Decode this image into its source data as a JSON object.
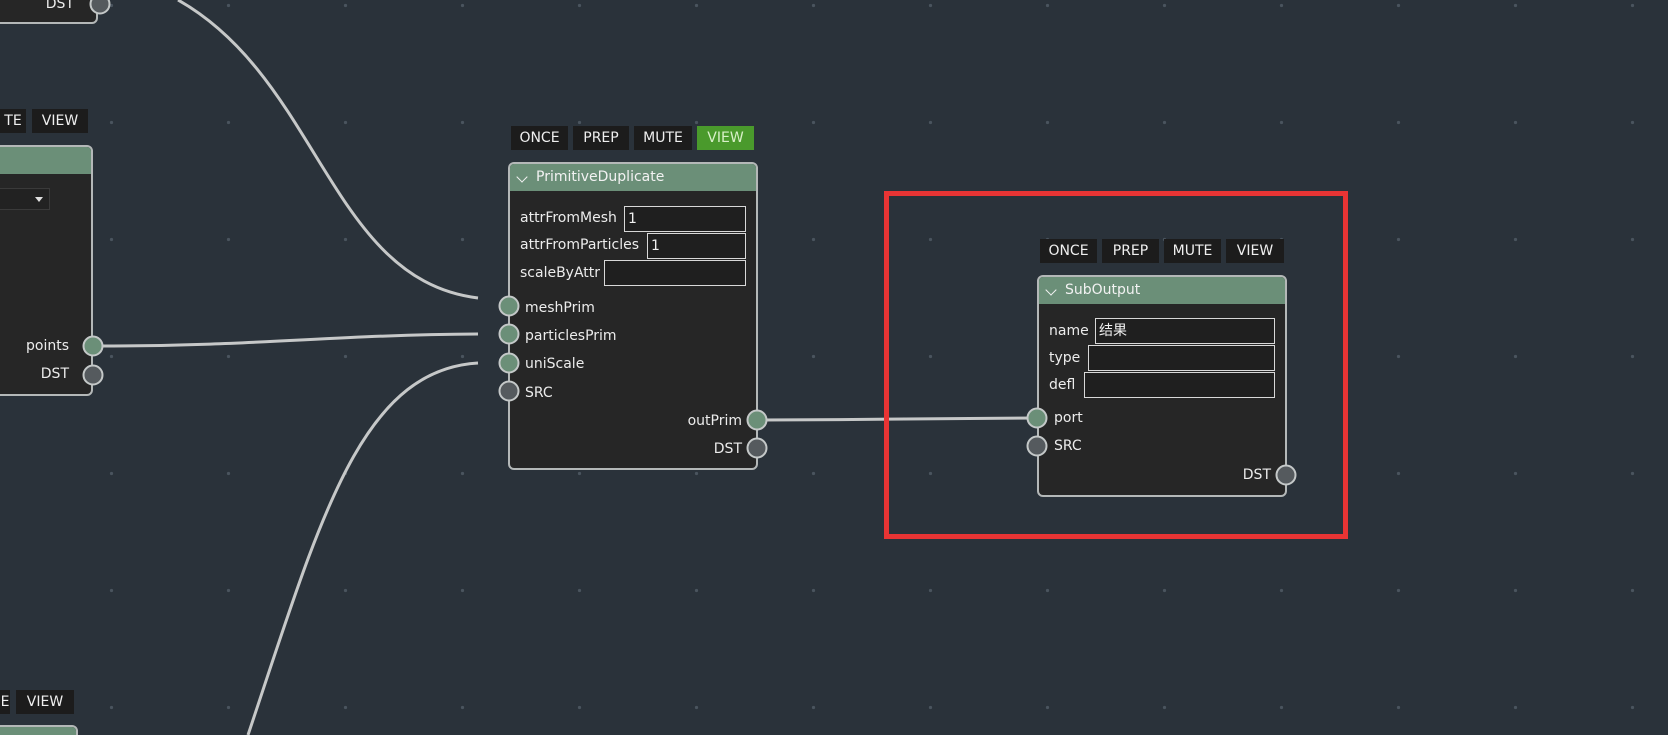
{
  "colors": {
    "background": "#2a323a",
    "node_header": "#6b8f78",
    "node_body": "#262626",
    "view_active": "#4a9a2c",
    "highlight": "#e83434"
  },
  "left_top_node": {
    "ports": {
      "dst": "DST"
    }
  },
  "left_mid_node": {
    "buttons": {
      "mute_partial": "TE",
      "view": "VIEW"
    },
    "ports": {
      "points": "points",
      "dst": "DST"
    }
  },
  "left_bottom_node": {
    "buttons": {
      "mute_partial": "E",
      "view": "VIEW"
    }
  },
  "primitive_duplicate": {
    "title": "PrimitiveDuplicate",
    "buttons": {
      "once": "ONCE",
      "prep": "PREP",
      "mute": "MUTE",
      "view": "VIEW"
    },
    "fields": {
      "attrFromMesh": {
        "label": "attrFromMesh",
        "value": "1"
      },
      "attrFromParticles": {
        "label": "attrFromParticles",
        "value": "1"
      },
      "scaleByAttr": {
        "label": "scaleByAttr",
        "value": ""
      }
    },
    "inputs": {
      "meshPrim": "meshPrim",
      "particlesPrim": "particlesPrim",
      "uniScale": "uniScale",
      "src": "SRC"
    },
    "outputs": {
      "outPrim": "outPrim",
      "dst": "DST"
    }
  },
  "sub_output": {
    "title": "SubOutput",
    "buttons": {
      "once": "ONCE",
      "prep": "PREP",
      "mute": "MUTE",
      "view": "VIEW"
    },
    "fields": {
      "name": {
        "label": "name",
        "value": "结果"
      },
      "type": {
        "label": "type",
        "value": ""
      },
      "defl": {
        "label": "defl",
        "value": ""
      }
    },
    "inputs": {
      "port": "port",
      "src": "SRC"
    },
    "outputs": {
      "dst": "DST"
    }
  }
}
